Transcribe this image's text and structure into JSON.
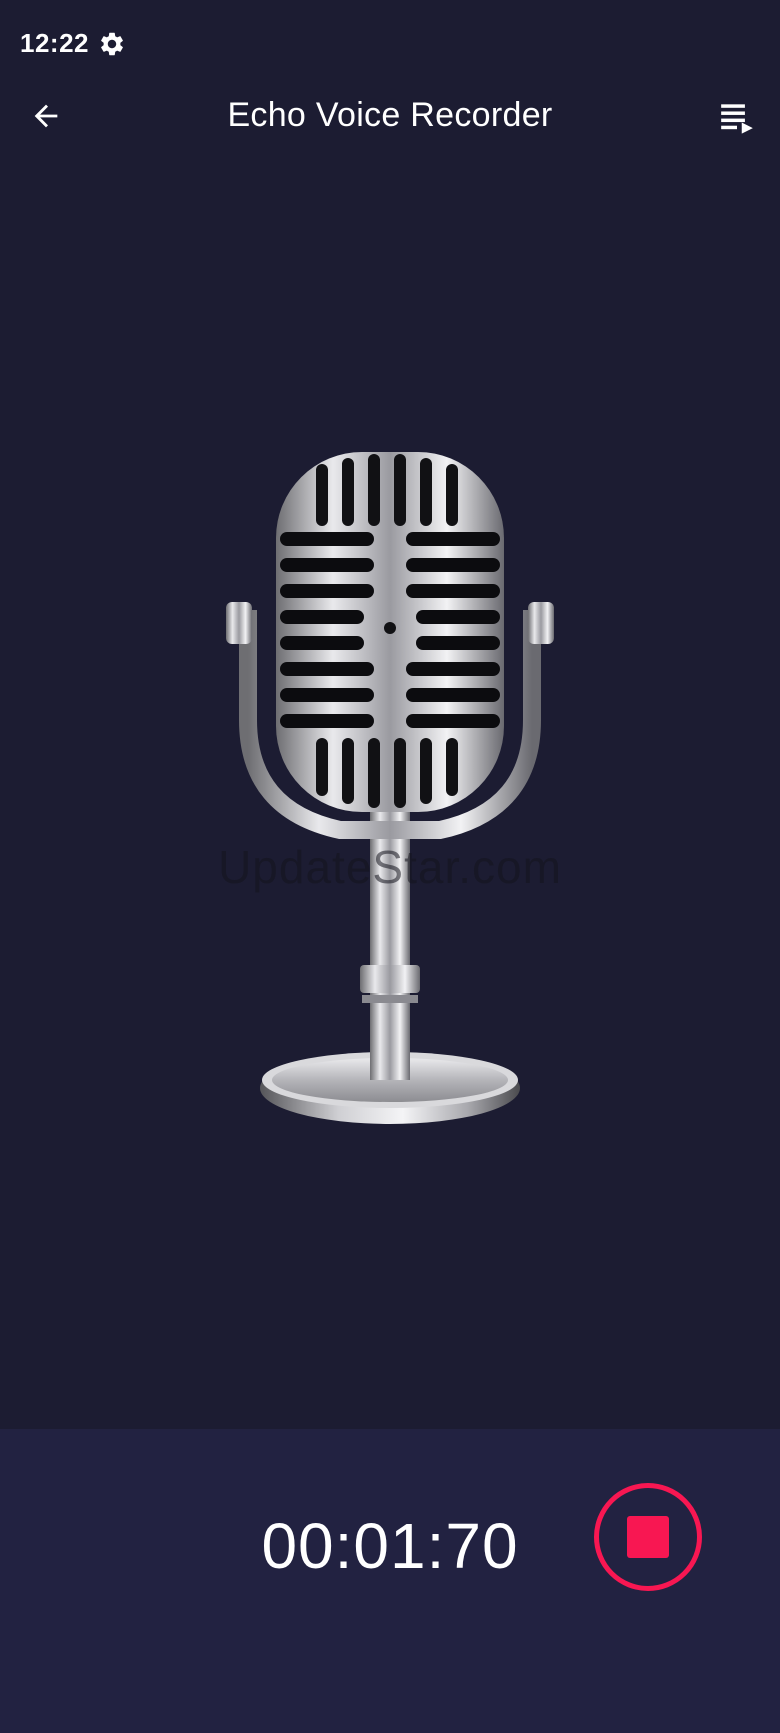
{
  "status_bar": {
    "time": "12:22",
    "settings_icon": "gear-icon"
  },
  "app_bar": {
    "title": "Echo Voice Recorder",
    "back_icon": "arrow-left-icon",
    "playlist_icon": "playlist-play-icon"
  },
  "watermark": "UpdateStar.com",
  "recorder": {
    "timer": "00:01:70",
    "stop_icon": "stop-icon"
  },
  "colors": {
    "background": "#1c1c32",
    "bottom_panel": "#222241",
    "accent": "#f81752",
    "text": "#ffffff"
  }
}
